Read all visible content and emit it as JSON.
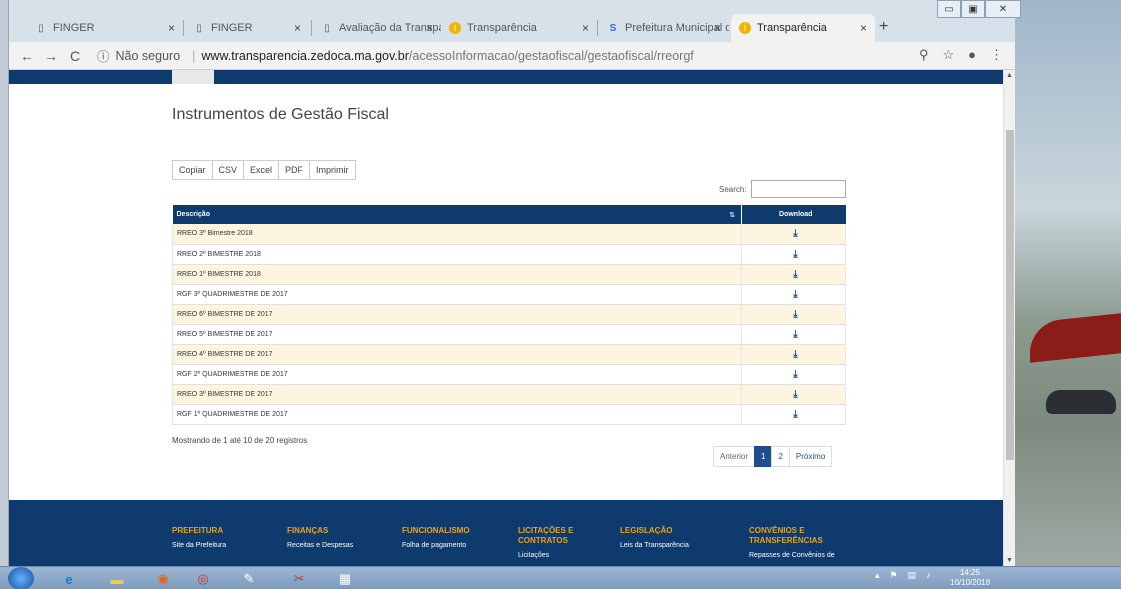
{
  "browser": {
    "tabs": [
      {
        "title": "FINGER",
        "icon": "document-icon"
      },
      {
        "title": "FINGER",
        "icon": "document-icon"
      },
      {
        "title": "Avaliação da Transparê",
        "icon": "document-icon"
      },
      {
        "title": "Transparência",
        "icon": "info-favicon"
      },
      {
        "title": "Prefeitura Municipal de",
        "icon": "s-favicon"
      },
      {
        "title": "Transparência",
        "icon": "info-favicon",
        "active": true
      }
    ],
    "new_tab": "+",
    "security_label": "Não seguro",
    "url_host": "www.transparencia.zedoca.ma.gov.br",
    "url_path": "/acessoInformacao/gestaofiscal/gestaofiscal/rreorgf"
  },
  "page": {
    "title": "Instrumentos de Gestão Fiscal",
    "export_buttons": [
      "Copiar",
      "CSV",
      "Excel",
      "PDF",
      "Imprimir"
    ],
    "search_label": "Search:",
    "table": {
      "headers": [
        "Descrição",
        "Download"
      ],
      "rows": [
        "RREO 3º Bimestre 2018",
        "RREO 2º BIMESTRE 2018",
        "RREO 1º BIMESTRE 2018",
        "RGF 3º QUADRIMESTRE DE 2017",
        "RREO 6º BIMESTRE DE 2017",
        "RREO 5º BIMESTRE DE 2017",
        "RREO 4º BIMESTRE DE 2017",
        "RGF 2º QUADRIMESTRE DE 2017",
        "RREO 3º BIMESTRE DE 2017",
        "RGF 1º QUADRIMESTRE DE 2017"
      ],
      "download_glyph": "⤓"
    },
    "info": "Mostrando de 1 até 10 de 20 registros",
    "pagination": {
      "prev": "Anterior",
      "pages": [
        "1",
        "2"
      ],
      "next": "Próximo",
      "current": "1"
    }
  },
  "footer": {
    "columns": [
      {
        "heading": "PREFEITURA",
        "link": "Site da Prefeitura"
      },
      {
        "heading": "FINANÇAS",
        "link": "Receitas e Despesas"
      },
      {
        "heading": "FUNCIONALISMO",
        "link": "Folha de pagamento"
      },
      {
        "heading": "LICITAÇÕES E CONTRATOS",
        "link": "Licitações"
      },
      {
        "heading": "LEGISLAÇÃO",
        "link": "Leis da Transparência"
      },
      {
        "heading": "CONVÊNIOS E TRANSFERÊNCIAS",
        "link": "Repasses de Convênios de"
      }
    ]
  },
  "taskbar": {
    "time": "14:25",
    "date": "10/10/2018"
  },
  "colors": {
    "primary": "#0e3a6e",
    "accent": "#e8a31a",
    "row_alt": "#fdf5e0"
  }
}
